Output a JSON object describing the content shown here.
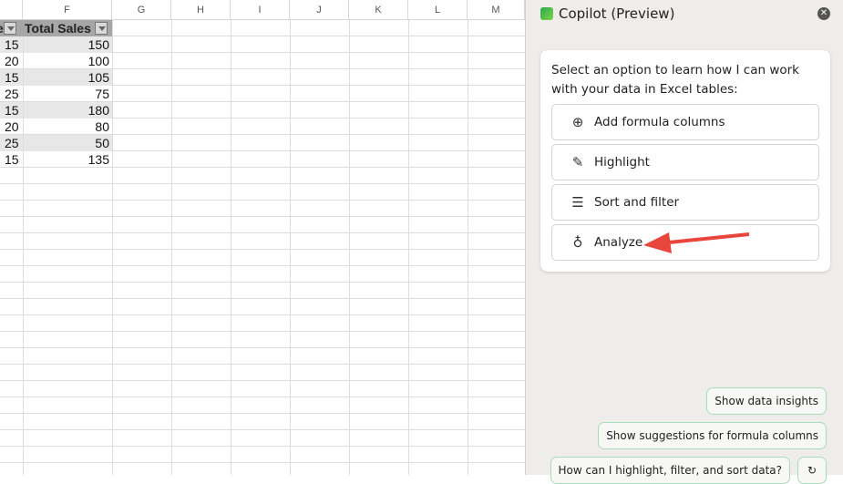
{
  "sheet": {
    "columns": [
      "F",
      "G",
      "H",
      "I",
      "J",
      "K",
      "L",
      "M"
    ],
    "header": {
      "partial_col": "e",
      "total_sales": "Total Sales"
    },
    "rows": [
      [
        "15",
        "150"
      ],
      [
        "20",
        "100"
      ],
      [
        "15",
        "105"
      ],
      [
        "25",
        "75"
      ],
      [
        "15",
        "180"
      ],
      [
        "20",
        "80"
      ],
      [
        "25",
        "50"
      ],
      [
        "15",
        "135"
      ]
    ]
  },
  "copilot": {
    "title": "Copilot (Preview)",
    "intro": "Select an option to learn how I can work with your data in Excel tables:",
    "options": [
      {
        "label": "Add formula columns",
        "icon": "plus-circle-icon"
      },
      {
        "label": "Highlight",
        "icon": "pen-icon"
      },
      {
        "label": "Sort and filter",
        "icon": "filter-icon"
      },
      {
        "label": "Analyze",
        "icon": "lightbulb-icon"
      }
    ],
    "suggestions": [
      "Show data insights",
      "Show suggestions for formula columns",
      "How can I highlight, filter, and sort data?"
    ],
    "accent": "#e8453c"
  }
}
